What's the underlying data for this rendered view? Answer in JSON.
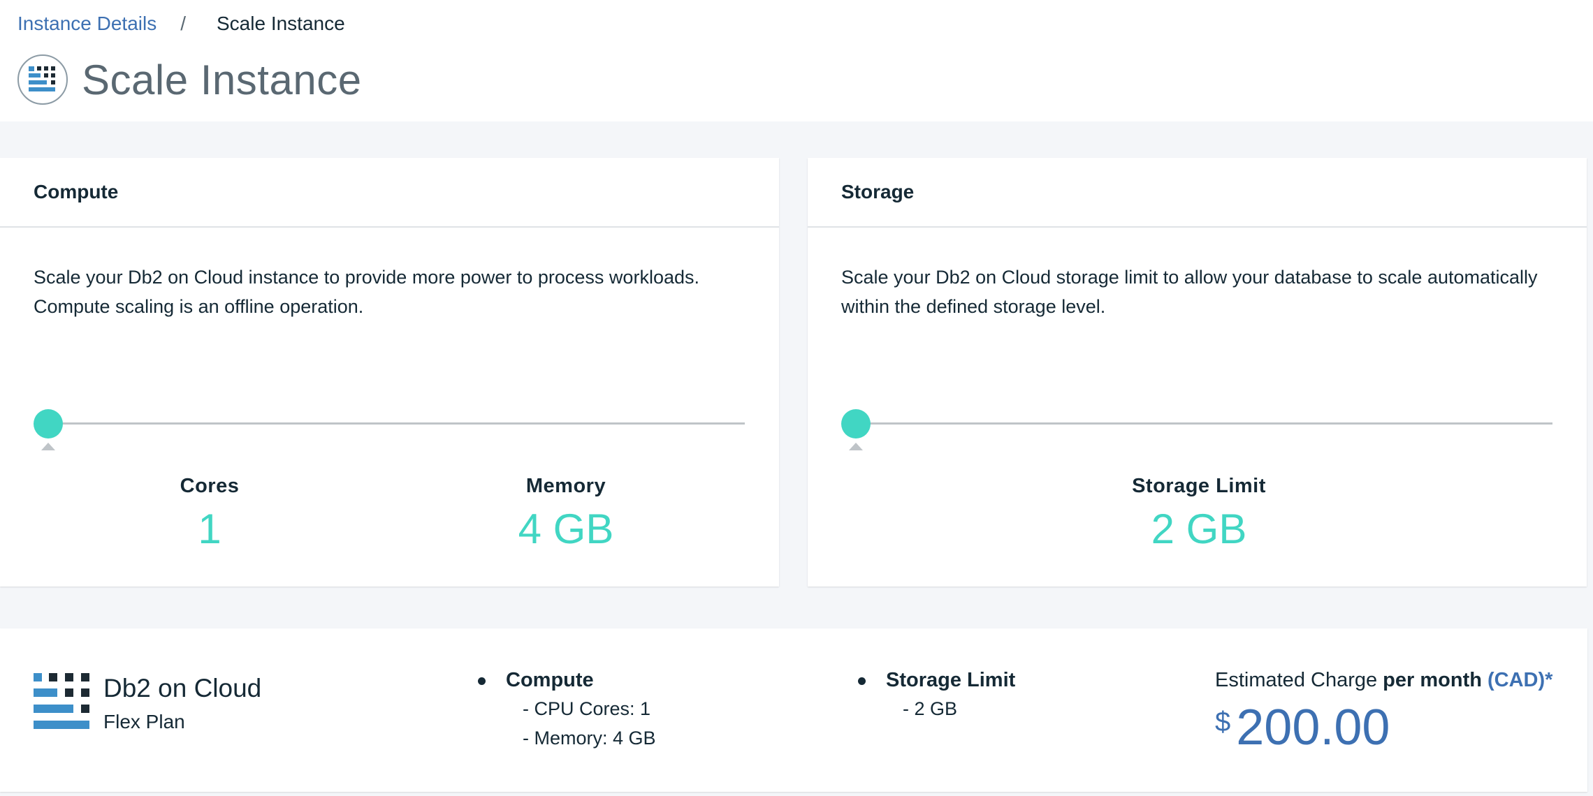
{
  "breadcrumb": {
    "parent": "Instance Details",
    "separator": "/",
    "current": "Scale Instance"
  },
  "page": {
    "title": "Scale Instance"
  },
  "compute": {
    "heading": "Compute",
    "description": "Scale your Db2 on Cloud instance to provide more power to process workloads. Compute scaling is an offline operation.",
    "slider_level": 0,
    "cores_label": "Cores",
    "cores_value": "1",
    "memory_label": "Memory",
    "memory_value": "4 GB"
  },
  "storage": {
    "heading": "Storage",
    "description": "Scale your Db2 on Cloud storage limit to allow your database to scale automatically within the defined storage level.",
    "slider_level": 0,
    "limit_label": "Storage Limit",
    "limit_value": "2 GB"
  },
  "summary": {
    "plan_name": "Db2 on Cloud",
    "plan_type": "Flex Plan",
    "compute_title": "Compute",
    "compute_cores": "- CPU Cores: 1",
    "compute_memory": "- Memory: 4 GB",
    "storage_title": "Storage Limit",
    "storage_value": "- 2 GB",
    "estimate_prefix": "Estimated Charge ",
    "estimate_period": "per month",
    "estimate_currency_code": "(CAD)*",
    "currency_symbol": "$",
    "amount": "200.00"
  },
  "colors": {
    "accent_teal": "#41d6c3",
    "link_blue": "#3d70b2",
    "logo_blue": "#3d8fc9",
    "logo_dark": "#1d2a33"
  },
  "icons": {
    "title_icon": "db2-logo-icon",
    "plan_icon": "db2-logo-icon"
  }
}
